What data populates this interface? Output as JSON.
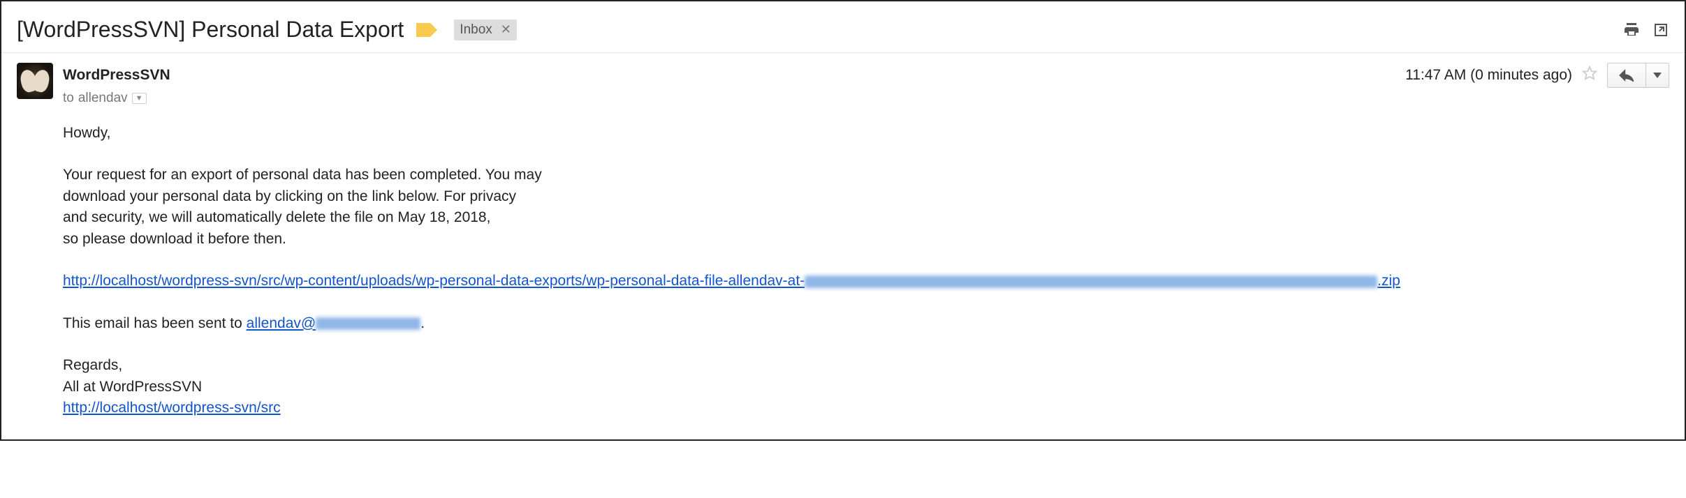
{
  "subject": {
    "title": "[WordPressSVN] Personal Data Export",
    "inbox_label": "Inbox"
  },
  "sender": {
    "name": "WordPressSVN",
    "to_prefix": "to",
    "to_recipient": "allendav"
  },
  "meta": {
    "timestamp": "11:47 AM (0 minutes ago)"
  },
  "body": {
    "greeting": "Howdy,",
    "para1_l1": "Your request for an export of personal data has been completed. You may",
    "para1_l2": "download your personal data by clicking on the link below. For privacy",
    "para1_l3": "and security, we will automatically delete the file on May 18, 2018,",
    "para1_l4": "so please download it before then.",
    "export_link_prefix": "http://localhost/wordpress-svn/src/wp-content/uploads/wp-personal-data-exports/wp-personal-data-file-allendav-at-",
    "export_link_suffix": ".zip",
    "sent_to_prefix": "This email has been sent to ",
    "sent_to_email_visible": "allendav@",
    "sent_to_suffix": ".",
    "regards": "Regards,",
    "signoff": "All at WordPressSVN",
    "site_link": "http://localhost/wordpress-svn/src"
  }
}
